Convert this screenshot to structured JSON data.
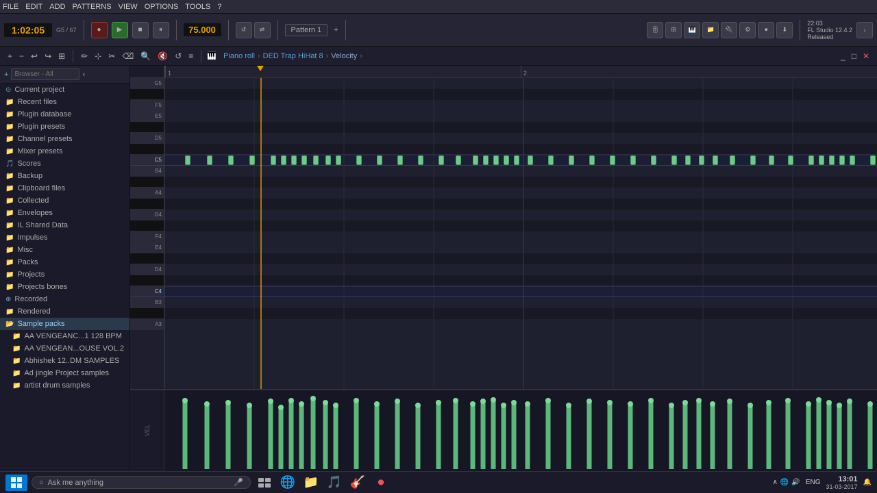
{
  "menu": {
    "items": [
      "FILE",
      "EDIT",
      "ADD",
      "PATTERNS",
      "VIEW",
      "OPTIONS",
      "TOOLS",
      "?"
    ]
  },
  "transport": {
    "time": "1:02:05",
    "note": "G5 / 67",
    "bpm": "75.000",
    "pattern": "Pattern 1",
    "status": "Released"
  },
  "breadcrumb": {
    "items": [
      "Piano roll",
      "DED Trap HiHat 8",
      "Velocity"
    ],
    "separator": "›"
  },
  "sidebar": {
    "search_placeholder": "Browser - All",
    "items": [
      {
        "label": "Current project",
        "icon": "folder",
        "type": "special"
      },
      {
        "label": "Recent files",
        "icon": "folder",
        "type": "folder"
      },
      {
        "label": "Plugin database",
        "icon": "folder",
        "type": "folder"
      },
      {
        "label": "Plugin presets",
        "icon": "folder",
        "type": "folder"
      },
      {
        "label": "Channel presets",
        "icon": "folder",
        "type": "folder"
      },
      {
        "label": "Mixer presets",
        "icon": "folder",
        "type": "folder"
      },
      {
        "label": "Scores",
        "icon": "folder",
        "type": "folder"
      },
      {
        "label": "Backup",
        "icon": "folder",
        "type": "folder"
      },
      {
        "label": "Clipboard files",
        "icon": "folder",
        "type": "folder"
      },
      {
        "label": "Collected",
        "icon": "folder",
        "type": "folder"
      },
      {
        "label": "Envelopes",
        "icon": "folder",
        "type": "folder"
      },
      {
        "label": "IL Shared Data",
        "icon": "folder",
        "type": "folder"
      },
      {
        "label": "Impulses",
        "icon": "folder",
        "type": "folder"
      },
      {
        "label": "Misc",
        "icon": "folder",
        "type": "folder"
      },
      {
        "label": "Packs",
        "icon": "folder",
        "type": "folder"
      },
      {
        "label": "Projects",
        "icon": "folder",
        "type": "folder"
      },
      {
        "label": "Projects bones",
        "icon": "folder",
        "type": "folder"
      },
      {
        "label": "Recorded",
        "icon": "folder",
        "type": "special"
      },
      {
        "label": "Rendered",
        "icon": "folder",
        "type": "folder"
      },
      {
        "label": "Sample packs",
        "icon": "folder",
        "type": "folder",
        "expanded": true
      },
      {
        "label": "AA VENGEANC...1 128 BPM",
        "icon": "folder",
        "type": "sub"
      },
      {
        "label": "AA VENGEAN...OUSE VOL.2",
        "icon": "folder",
        "type": "sub"
      },
      {
        "label": "Abhishek 12..DM SAMPLES",
        "icon": "folder",
        "type": "sub"
      },
      {
        "label": "Ad jingle Project samples",
        "icon": "folder",
        "type": "sub"
      },
      {
        "label": "artist drum samples",
        "icon": "folder",
        "type": "sub"
      }
    ]
  },
  "piano_roll": {
    "title": "Piano roll - DED Trap HiHat 8",
    "notes_label": "G5",
    "bar_count": 2
  },
  "taskbar": {
    "search_placeholder": "Ask me anything",
    "search_icon": "🔍",
    "mic_icon": "🎤",
    "time": "13:01",
    "date": "31-03-2017",
    "lang": "ENG"
  },
  "fl_studio": {
    "version": "FL Studio 12.4.2",
    "time": "22:03"
  },
  "piano_keys": [
    {
      "note": "G5",
      "type": "white"
    },
    {
      "note": "",
      "type": "black"
    },
    {
      "note": "F5",
      "type": "white"
    },
    {
      "note": "E5",
      "type": "white"
    },
    {
      "note": "",
      "type": "black"
    },
    {
      "note": "D5",
      "type": "white"
    },
    {
      "note": "",
      "type": "black"
    },
    {
      "note": "C5",
      "type": "white"
    },
    {
      "note": "B4",
      "type": "white"
    },
    {
      "note": "",
      "type": "black"
    },
    {
      "note": "A4",
      "type": "white"
    },
    {
      "note": "",
      "type": "black"
    },
    {
      "note": "G4",
      "type": "white"
    },
    {
      "note": "",
      "type": "black"
    },
    {
      "note": "F4",
      "type": "white"
    },
    {
      "note": "E4",
      "type": "white"
    },
    {
      "note": "",
      "type": "black"
    },
    {
      "note": "D4",
      "type": "white"
    },
    {
      "note": "",
      "type": "black"
    },
    {
      "note": "C4",
      "type": "white"
    },
    {
      "note": "B3",
      "type": "white"
    },
    {
      "note": "",
      "type": "black"
    },
    {
      "note": "A3",
      "type": "white"
    }
  ]
}
